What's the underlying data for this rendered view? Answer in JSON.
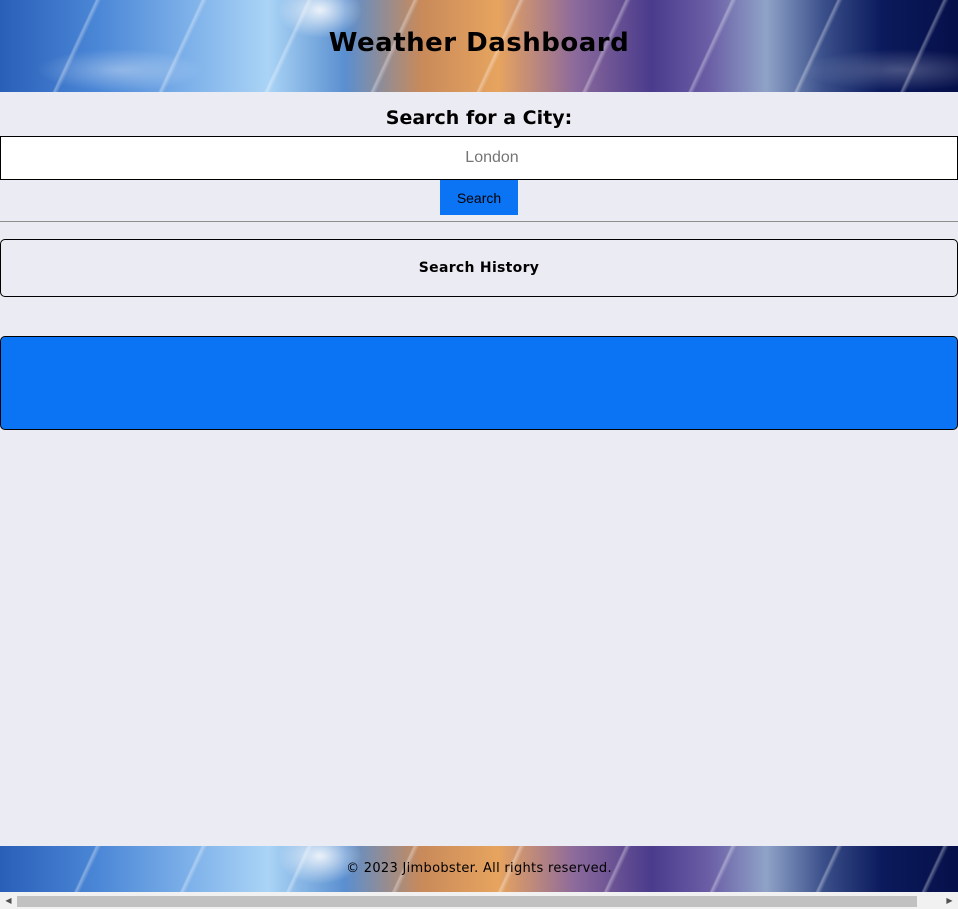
{
  "header": {
    "title": "Weather Dashboard"
  },
  "search": {
    "label": "Search for a City:",
    "placeholder": "London",
    "value": "",
    "button_label": "Search"
  },
  "history": {
    "title": "Search History"
  },
  "footer": {
    "text": "© 2023 Jimbobster. All rights reserved."
  },
  "scrollbar": {
    "left_arrow": "◀",
    "right_arrow": "▶"
  },
  "colors": {
    "page_background": "#ebecf3",
    "accent_blue": "#0b74f4"
  }
}
